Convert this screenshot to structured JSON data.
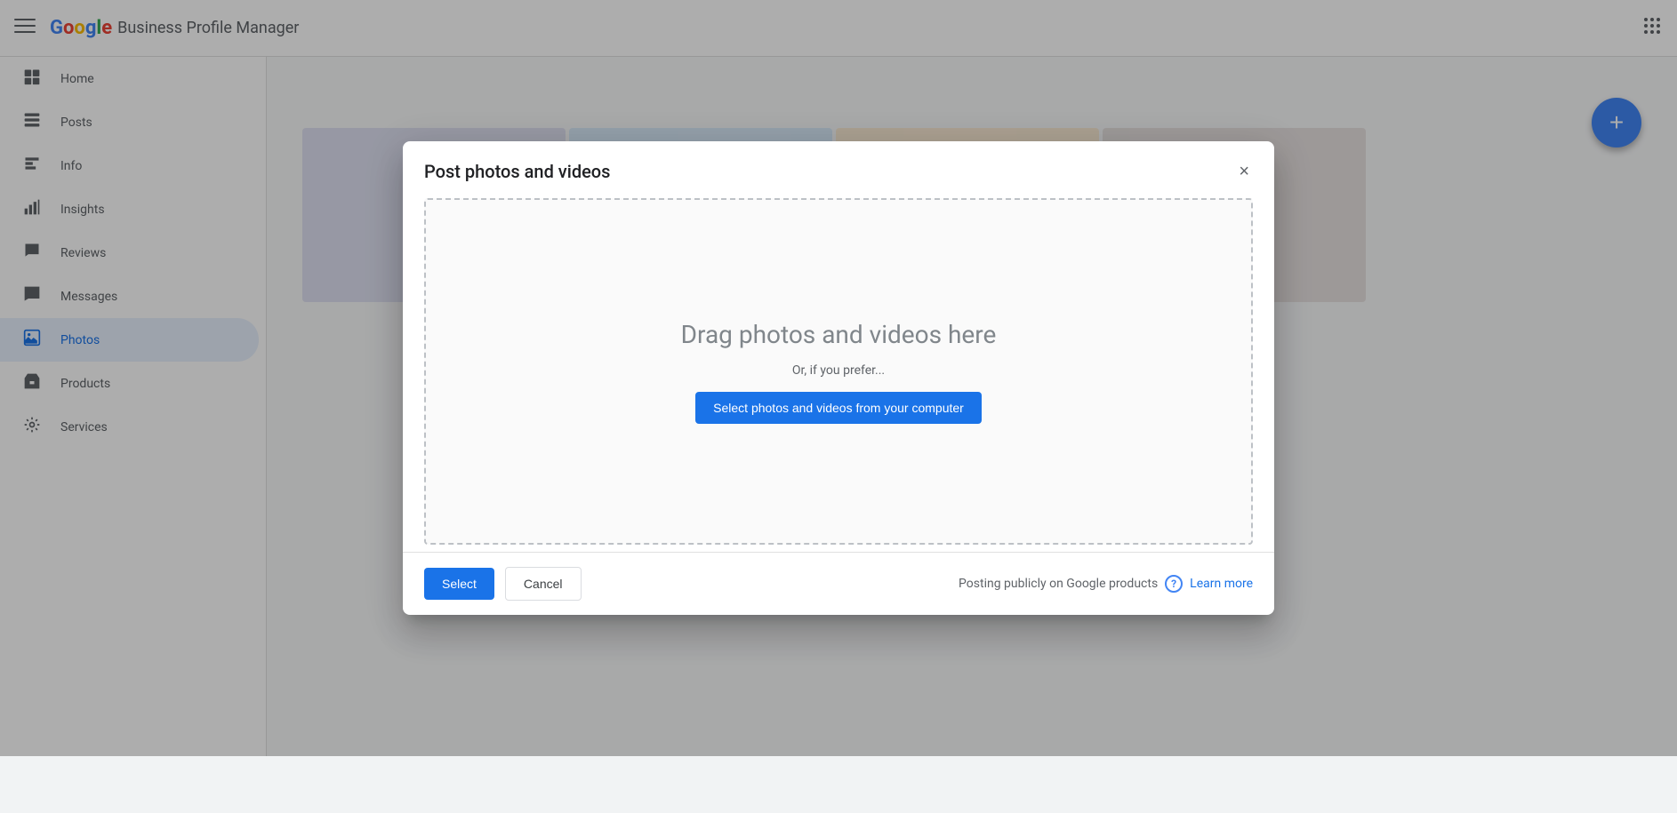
{
  "app": {
    "title": "Google Business Profile Manager",
    "logo": {
      "g1": "G",
      "o1": "o",
      "o2": "o",
      "g2": "g",
      "l": "l",
      "e": "e",
      "subtitle": "Business Profile Manager"
    }
  },
  "sidebar": {
    "items": [
      {
        "id": "home",
        "label": "Home",
        "icon": "⊞"
      },
      {
        "id": "posts",
        "label": "Posts",
        "icon": "▤"
      },
      {
        "id": "info",
        "label": "Info",
        "icon": "🏪"
      },
      {
        "id": "insights",
        "label": "Insights",
        "icon": "📊"
      },
      {
        "id": "reviews",
        "label": "Reviews",
        "icon": "🖊"
      },
      {
        "id": "messages",
        "label": "Messages",
        "icon": "💬"
      },
      {
        "id": "photos",
        "label": "Photos",
        "icon": "🖼"
      },
      {
        "id": "products",
        "label": "Products",
        "icon": "🛍"
      },
      {
        "id": "services",
        "label": "Services",
        "icon": "⚙"
      }
    ]
  },
  "fab": {
    "icon": "+",
    "label": "Add"
  },
  "modal": {
    "title": "Post photos and videos",
    "close_icon": "×",
    "dropzone": {
      "title": "Drag photos and videos here",
      "subtitle": "Or, if you prefer...",
      "select_label": "Select photos and videos from your computer"
    },
    "footer": {
      "select_label": "Select",
      "cancel_label": "Cancel",
      "posting_info": "Posting publicly on Google products",
      "learn_more": "Learn more",
      "help_icon": "?"
    }
  }
}
